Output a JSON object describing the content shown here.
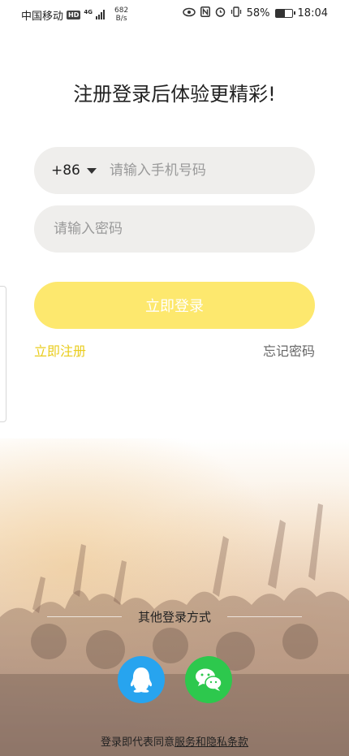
{
  "status_bar": {
    "carrier": "中国移动",
    "hd": "HD",
    "network": "4G",
    "speed_value": "682",
    "speed_unit": "B/s",
    "battery": "58%",
    "time": "18:04"
  },
  "title": "注册登录后体验更精彩!",
  "phone": {
    "country_code": "+86",
    "placeholder": "请输入手机号码",
    "value": ""
  },
  "password": {
    "placeholder": "请输入密码",
    "value": ""
  },
  "login_button_label": "立即登录",
  "register_link": "立即注册",
  "forgot_link": "忘记密码",
  "other_login_label": "其他登录方式",
  "social": {
    "qq_icon": "qq-icon",
    "wechat_icon": "wechat-icon"
  },
  "agreement": {
    "prefix": "登录即代表同意",
    "link": "服务和隐私条款"
  },
  "colors": {
    "accent": "#fde86e",
    "link_yellow": "#e9cc1c",
    "qq_blue": "#27a4ef",
    "wechat_green": "#2dc84d"
  }
}
